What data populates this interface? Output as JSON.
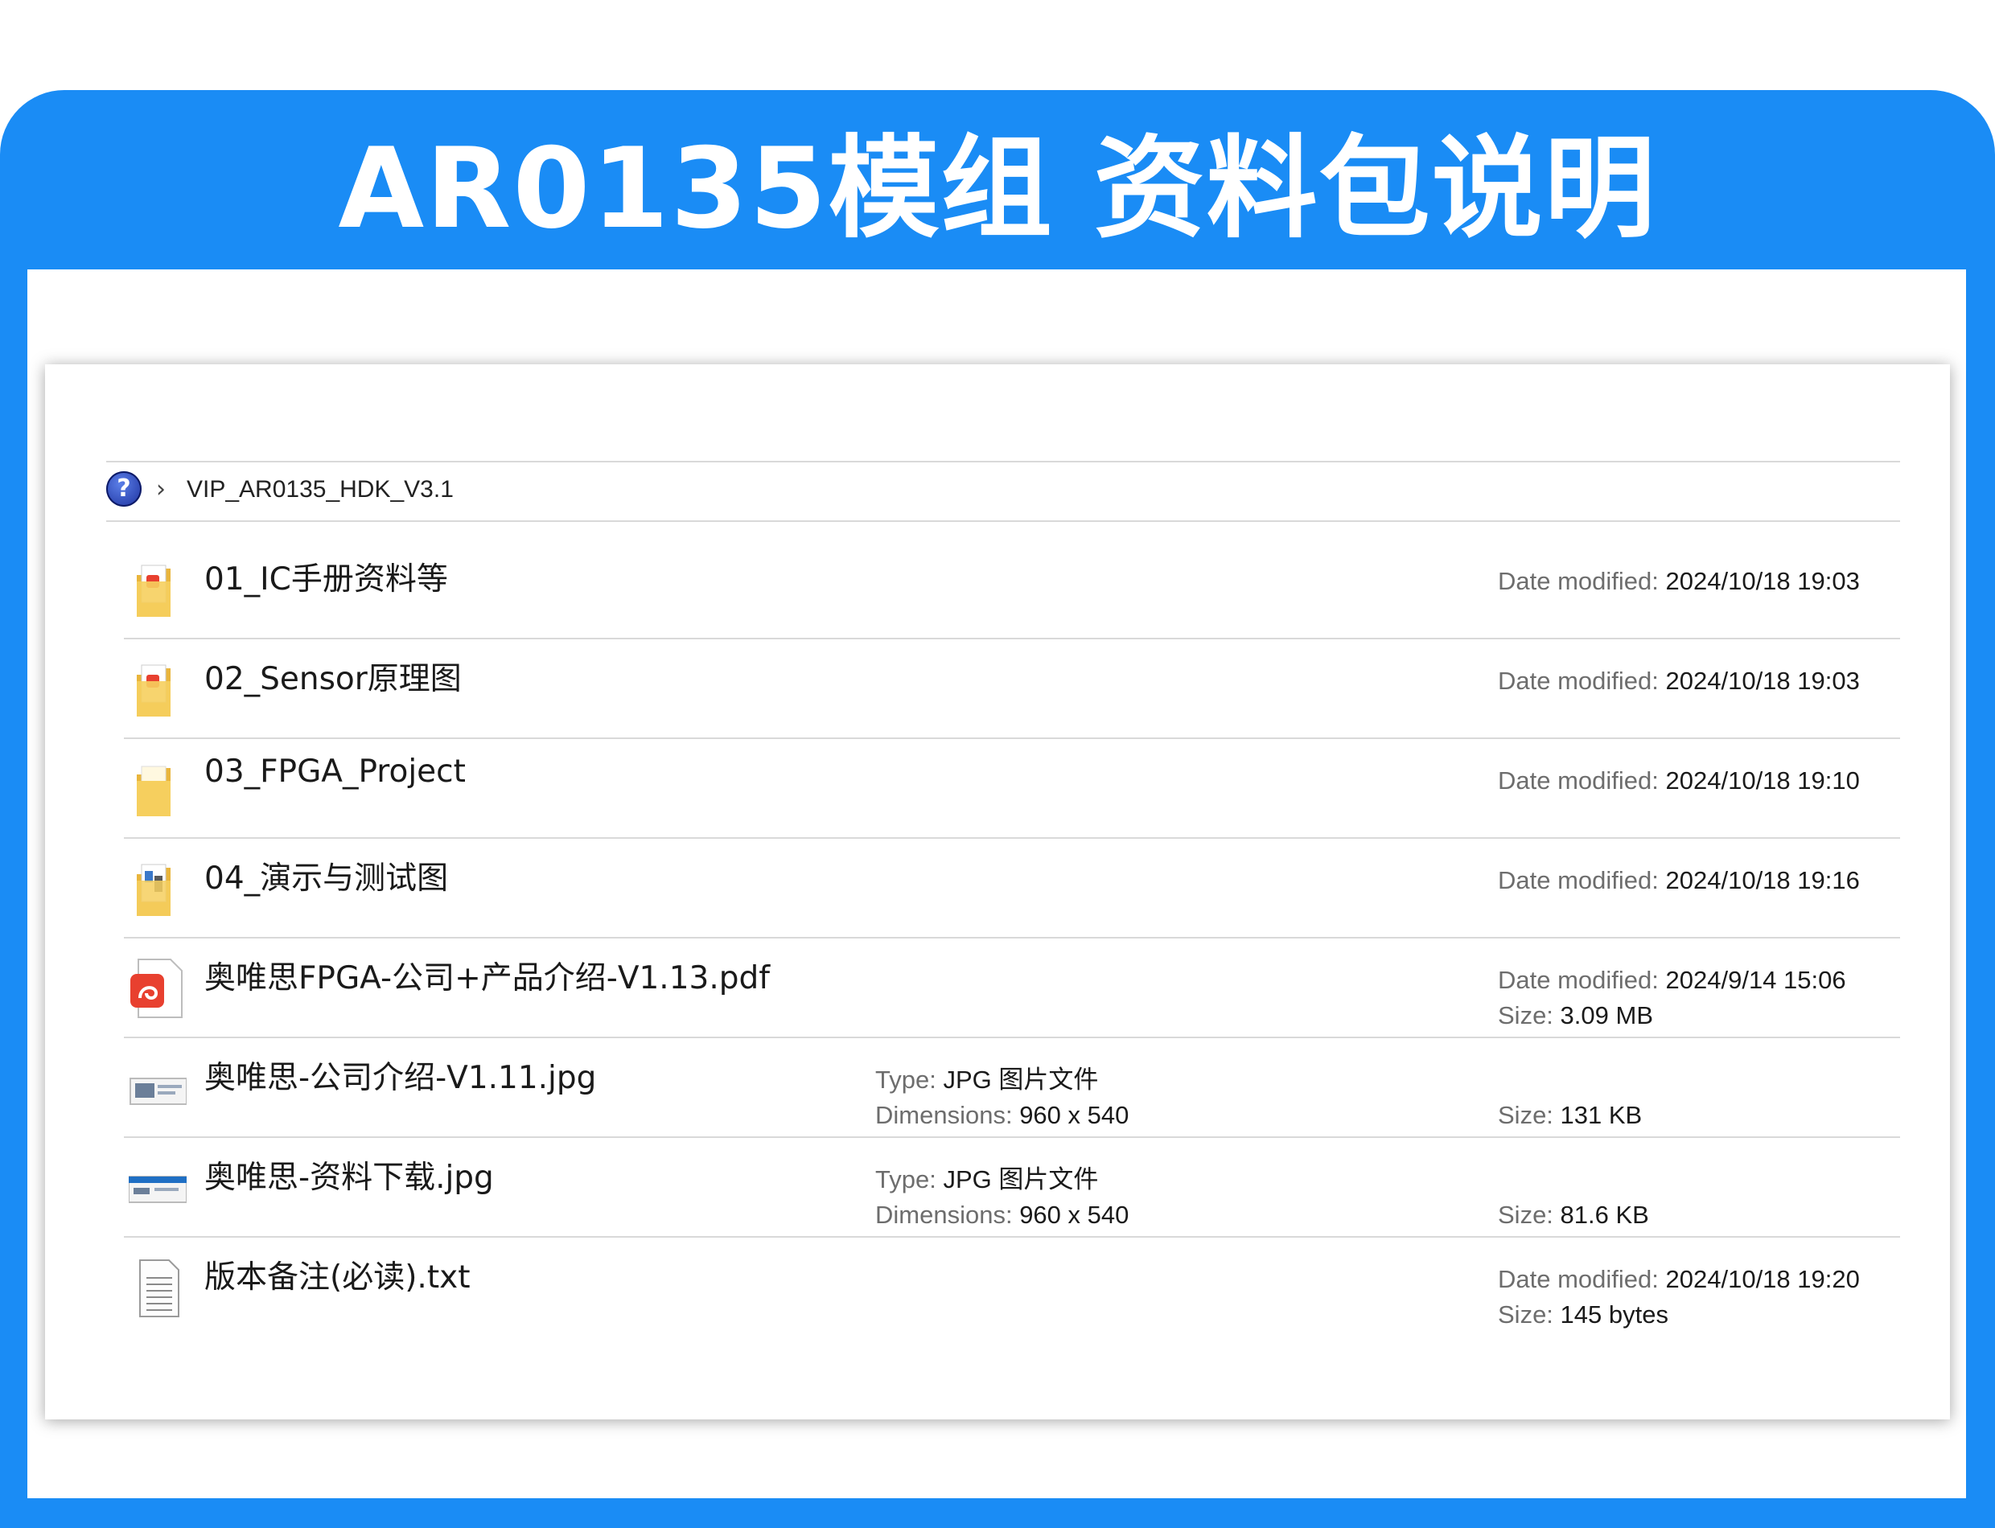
{
  "banner": {
    "title": "AR0135模组 资料包说明"
  },
  "explorer": {
    "breadcrumb": "VIP_AR0135_HDK_V3.1",
    "labels": {
      "date_modified": "Date modified:",
      "size": "Size:",
      "type": "Type:",
      "dimensions": "Dimensions:"
    },
    "items": [
      {
        "name": "01_IC手册资料等",
        "icon": "folder-pdf-icon",
        "date": "2024/10/18 19:03"
      },
      {
        "name": "02_Sensor原理图",
        "icon": "folder-pdf-icon",
        "date": "2024/10/18 19:03"
      },
      {
        "name": "03_FPGA_Project",
        "icon": "folder-icon",
        "date": "2024/10/18 19:10"
      },
      {
        "name": "04_演示与测试图",
        "icon": "folder-images-icon",
        "date": "2024/10/18 19:16"
      },
      {
        "name": "奥唯思FPGA-公司+产品介绍-V1.13.pdf",
        "icon": "pdf-file-icon",
        "date": "2024/9/14 15:06",
        "size": "3.09 MB"
      },
      {
        "name": "奥唯思-公司介绍-V1.11.jpg",
        "icon": "image-file-icon",
        "type": "JPG 图片文件",
        "dimensions": "960 x 540",
        "size": "131 KB"
      },
      {
        "name": "奥唯思-资料下载.jpg",
        "icon": "image-file-icon",
        "type": "JPG 图片文件",
        "dimensions": "960 x 540",
        "size": "81.6 KB"
      },
      {
        "name": "版本备注(必读).txt",
        "icon": "text-file-icon",
        "date": "2024/10/18 19:20",
        "size": "145 bytes"
      }
    ]
  },
  "colors": {
    "banner": "#1a8cf5",
    "folder": "#f3c24a",
    "pdf_red": "#e8402f"
  }
}
